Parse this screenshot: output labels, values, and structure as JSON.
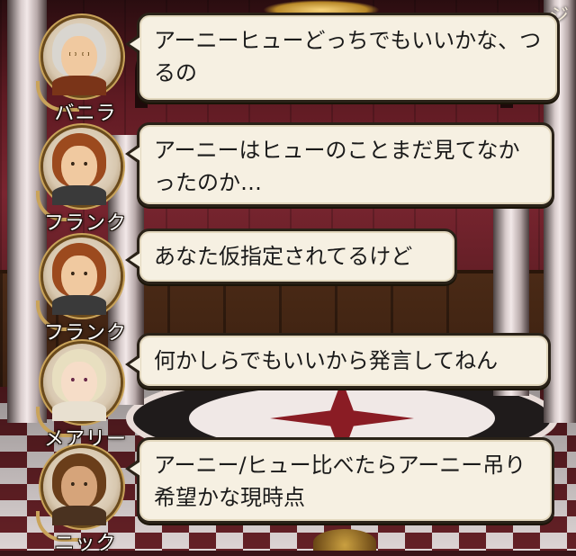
{
  "corner_text": "ジ",
  "messages": [
    {
      "speaker": "バニラ",
      "text": "アーニーヒューどっちでもいいかな、つるの",
      "portrait": "grandmother-portrait"
    },
    {
      "speaker": "フランク",
      "text": "アーニーはヒューのことまだ見てなかったのか…",
      "portrait": "redhead-man-portrait"
    },
    {
      "speaker": "フランク",
      "text": "あなた仮指定されてるけど",
      "portrait": "redhead-man-portrait"
    },
    {
      "speaker": "メアリー",
      "text": "何かしらでもいいから発言してねん",
      "portrait": "blonde-woman-portrait"
    },
    {
      "speaker": "ニック",
      "text": "アーニー/ヒュー比べたらアーニー吊り希望かな現時点",
      "portrait": "bearded-man-portrait"
    }
  ],
  "colors": {
    "bubble_bg": "#f6f0e2",
    "bubble_border": "#2a2218",
    "name_text": "#ffffff",
    "frame_gold": "#c9a35a"
  }
}
